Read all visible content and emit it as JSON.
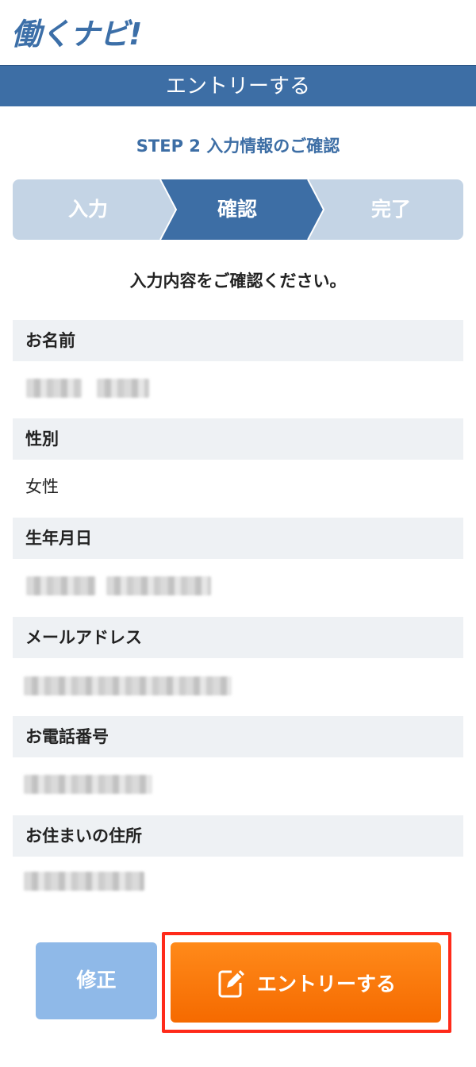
{
  "header": {
    "logo": "働くナビ!"
  },
  "title_bar": {
    "title": "エントリーする"
  },
  "step": {
    "title": "STEP 2 入力情報のご確認",
    "steps": [
      {
        "label": "入力",
        "active": false
      },
      {
        "label": "確認",
        "active": true
      },
      {
        "label": "完了",
        "active": false
      }
    ]
  },
  "lead": "入力内容をご確認ください。",
  "fields": [
    {
      "label": "お名前",
      "value": ""
    },
    {
      "label": "性別",
      "value": "女性"
    },
    {
      "label": "生年月日",
      "value": ""
    },
    {
      "label": "メールアドレス",
      "value": ""
    },
    {
      "label": "お電話番号",
      "value": ""
    },
    {
      "label": "お住まいの住所",
      "value": ""
    }
  ],
  "actions": {
    "fix_label": "修正",
    "entry_label": "エントリーする"
  },
  "colors": {
    "primary": "#3d6ea5",
    "step_inactive": "#c4d4e5",
    "accent": "#f57a0a",
    "highlight": "#ff2a1a"
  }
}
